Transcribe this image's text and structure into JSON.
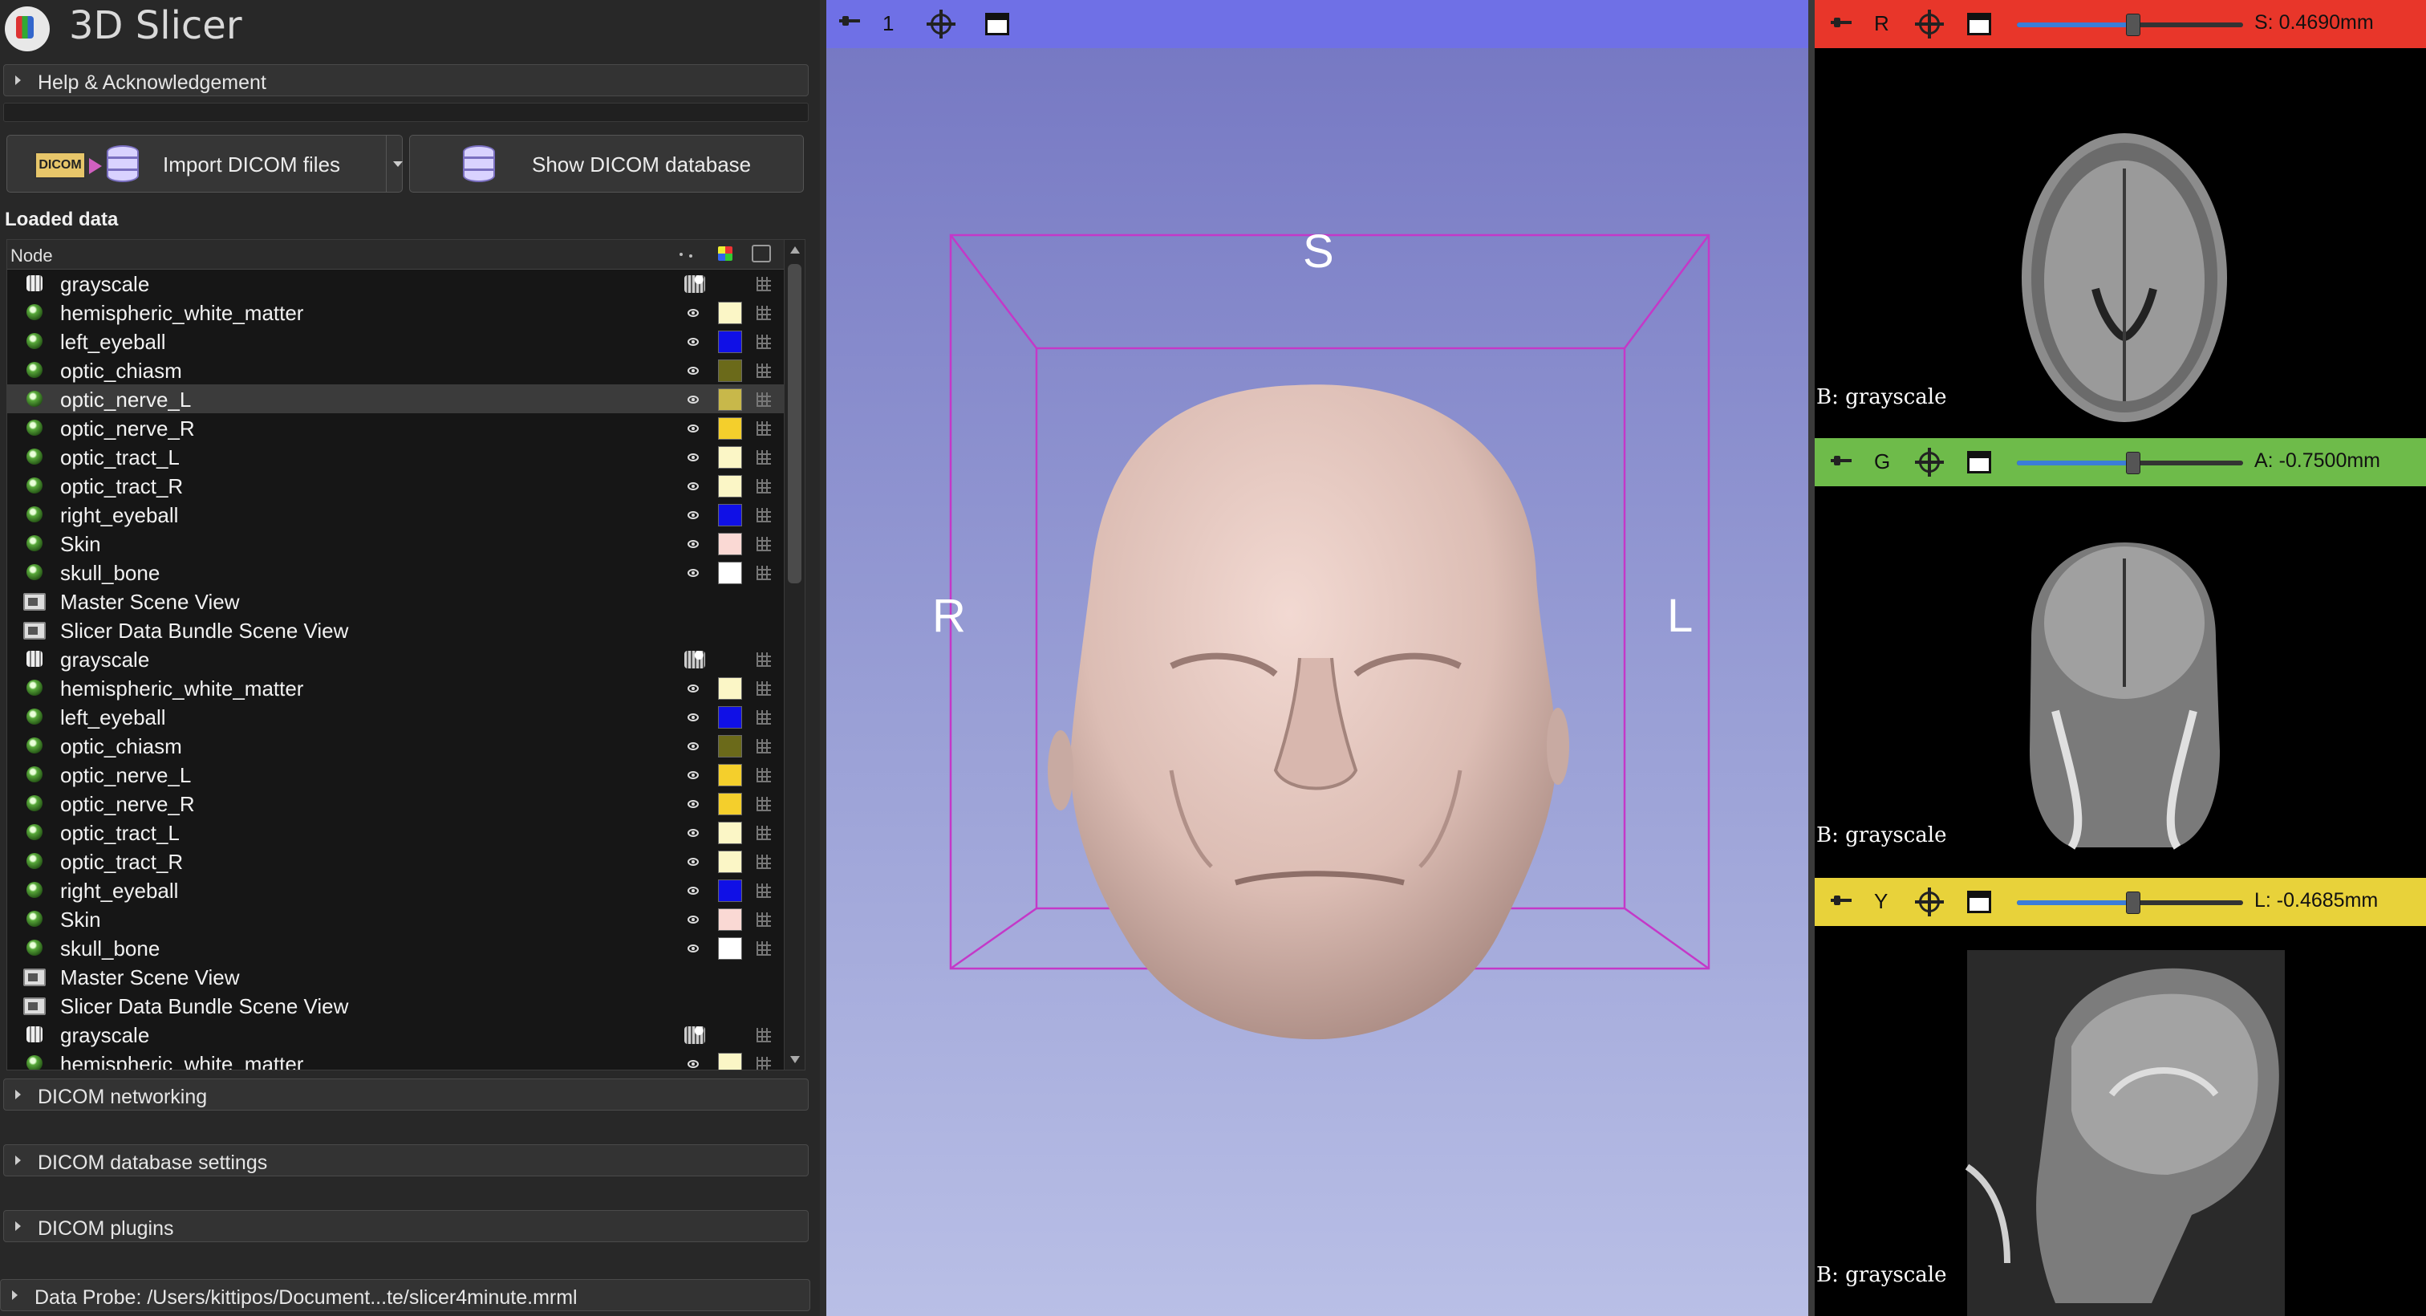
{
  "app": {
    "title": "3D Slicer"
  },
  "left_panel": {
    "help_section": "Help & Acknowledgement",
    "import_button": "Import DICOM files",
    "import_icon_text": "DICOM",
    "show_db_button": "Show DICOM database",
    "loaded_data_title": "Loaded data",
    "tree_header": "Node",
    "rows": [
      {
        "name": "grayscale",
        "type": "volume",
        "color": ""
      },
      {
        "name": "hemispheric_white_matter",
        "type": "model",
        "color": "#fbf6c6"
      },
      {
        "name": "left_eyeball",
        "type": "model",
        "color": "#1010e6"
      },
      {
        "name": "optic_chiasm",
        "type": "model",
        "color": "#6b6a1a"
      },
      {
        "name": "optic_nerve_L",
        "type": "model",
        "color": "#c8b84a"
      },
      {
        "name": "optic_nerve_R",
        "type": "model",
        "color": "#f4cf2c"
      },
      {
        "name": "optic_tract_L",
        "type": "model",
        "color": "#fbf6c6"
      },
      {
        "name": "optic_tract_R",
        "type": "model",
        "color": "#fbf6c6"
      },
      {
        "name": "right_eyeball",
        "type": "model",
        "color": "#1010e6"
      },
      {
        "name": "Skin",
        "type": "model",
        "color": "#fad9d4"
      },
      {
        "name": "skull_bone",
        "type": "model",
        "color": "#ffffff"
      },
      {
        "name": "Master Scene View",
        "type": "view",
        "color": ""
      },
      {
        "name": "Slicer Data Bundle Scene View",
        "type": "view",
        "color": ""
      },
      {
        "name": "grayscale",
        "type": "volume",
        "color": ""
      },
      {
        "name": "hemispheric_white_matter",
        "type": "model",
        "color": "#fbf6c6"
      },
      {
        "name": "left_eyeball",
        "type": "model",
        "color": "#1010e6"
      },
      {
        "name": "optic_chiasm",
        "type": "model",
        "color": "#6b6a1a"
      },
      {
        "name": "optic_nerve_L",
        "type": "model",
        "color": "#f4cf2c"
      },
      {
        "name": "optic_nerve_R",
        "type": "model",
        "color": "#f4cf2c"
      },
      {
        "name": "optic_tract_L",
        "type": "model",
        "color": "#fbf6c6"
      },
      {
        "name": "optic_tract_R",
        "type": "model",
        "color": "#fbf6c6"
      },
      {
        "name": "right_eyeball",
        "type": "model",
        "color": "#1010e6"
      },
      {
        "name": "Skin",
        "type": "model",
        "color": "#fad9d4"
      },
      {
        "name": "skull_bone",
        "type": "model",
        "color": "#ffffff"
      },
      {
        "name": "Master Scene View",
        "type": "view",
        "color": ""
      },
      {
        "name": "Slicer Data Bundle Scene View",
        "type": "view",
        "color": ""
      },
      {
        "name": "grayscale",
        "type": "volume",
        "color": ""
      },
      {
        "name": "hemispheric_white_matter",
        "type": "model",
        "color": "#fbf6c6"
      }
    ],
    "selected_row": 4,
    "sections": [
      "DICOM networking",
      "DICOM database settings",
      "DICOM plugins"
    ],
    "data_probe": "Data Probe: /Users/kittipos/Document...te/slicer4minute.mrml"
  },
  "view3d": {
    "layout_number": "1",
    "bar_color": "#6f70e6",
    "orientation": {
      "top": "S",
      "left": "R",
      "right": "L"
    }
  },
  "slices": [
    {
      "letter": "R",
      "color": "#e8362a",
      "value": "S: 0.4690mm",
      "slider_fraction": 0.51,
      "caption": "B: grayscale"
    },
    {
      "letter": "G",
      "color": "#6ebb4a",
      "value": "A: -0.7500mm",
      "slider_fraction": 0.51,
      "caption": "B: grayscale"
    },
    {
      "letter": "Y",
      "color": "#e8d23a",
      "value": "L: -0.4685mm",
      "slider_fraction": 0.51,
      "caption": "B: grayscale"
    }
  ]
}
